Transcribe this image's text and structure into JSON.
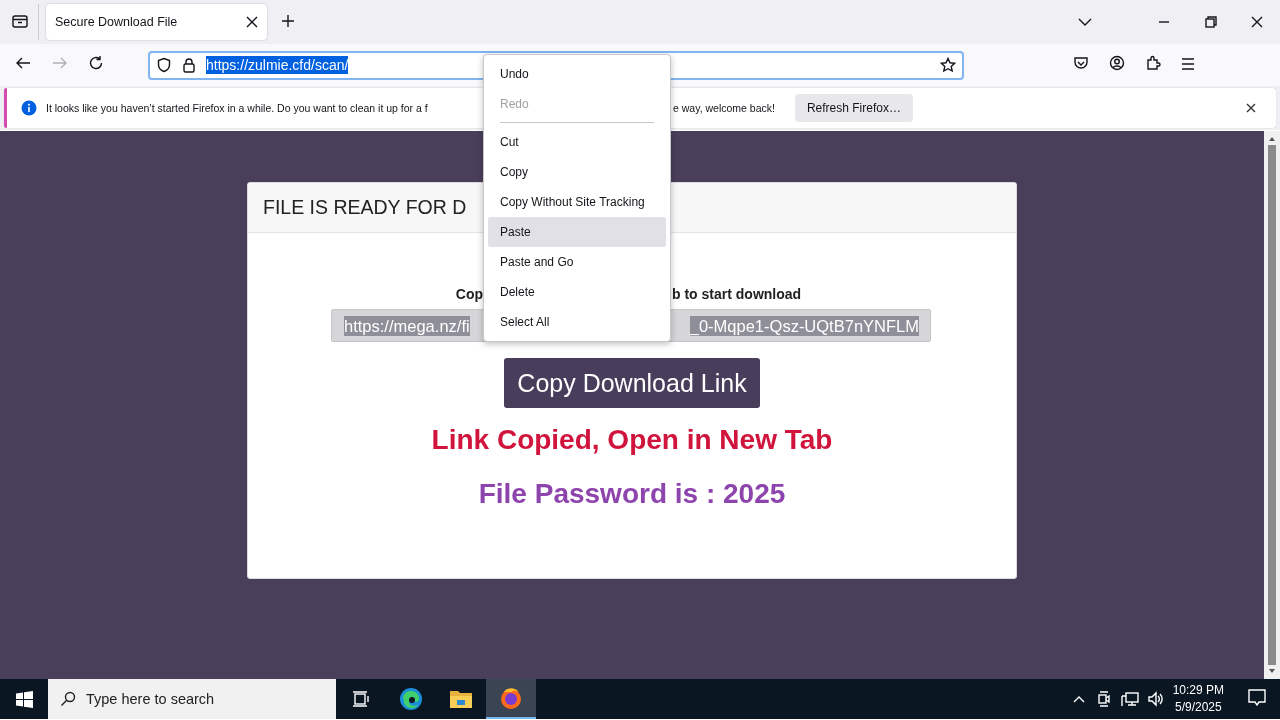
{
  "browser": {
    "tab_title": "Secure Download File",
    "url": "https://zulmie.cfd/scan/"
  },
  "notification": {
    "text_before": "It looks like you haven’t started Firefox in a while. Do you want to clean it up for a f",
    "text_after": "e way, welcome back!",
    "button": "Refresh Firefox…"
  },
  "page": {
    "heading": "FILE IS READY FOR D",
    "instruction_start": "Cop",
    "instruction_end": "b to start download",
    "link_start": "https://mega.nz/fi",
    "link_end": "_0-Mqpe1-Qsz-UQtB7nYNFLM",
    "button": "Copy Download Link",
    "status": "Link Copied, Open in New Tab",
    "password": "File Password is : 2025"
  },
  "context_menu": [
    {
      "kind": "item",
      "label": "Undo",
      "disabled": false,
      "selected": false
    },
    {
      "kind": "item",
      "label": "Redo",
      "disabled": true,
      "selected": false
    },
    {
      "kind": "separator"
    },
    {
      "kind": "item",
      "label": "Cut",
      "disabled": false,
      "selected": false
    },
    {
      "kind": "item",
      "label": "Copy",
      "disabled": false,
      "selected": false
    },
    {
      "kind": "item",
      "label": "Copy Without Site Tracking",
      "disabled": false,
      "selected": false
    },
    {
      "kind": "item",
      "label": "Paste",
      "disabled": false,
      "selected": true
    },
    {
      "kind": "item",
      "label": "Paste and Go",
      "disabled": false,
      "selected": false
    },
    {
      "kind": "item",
      "label": "Delete",
      "disabled": false,
      "selected": false
    },
    {
      "kind": "item",
      "label": "Select All",
      "disabled": false,
      "selected": false
    }
  ],
  "taskbar": {
    "search_placeholder": "Type here to search",
    "time": "10:29 PM",
    "date": "5/9/2025"
  }
}
